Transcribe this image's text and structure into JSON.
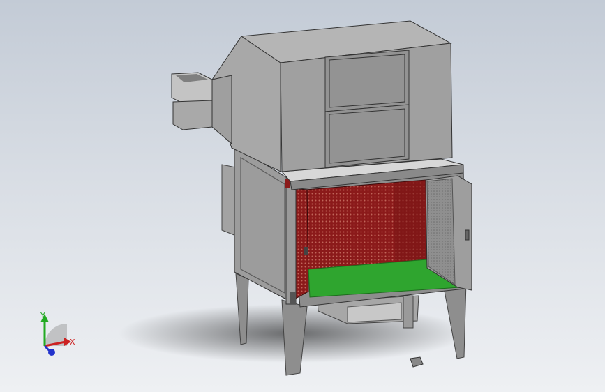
{
  "viewport": {
    "background_top": "#c3cbd6",
    "background_bottom": "#eef0f3"
  },
  "model": {
    "body_color": "#9a9a9a",
    "body_dark": "#7c7c7c",
    "body_light": "#b4b4b4",
    "filter_color": "#8b1a1a",
    "floor_color": "#2fa52f",
    "door_mesh_color": "#8a8a8a"
  },
  "triad": {
    "x_label": "X",
    "y_label": "Y",
    "x_color": "#cc2222",
    "y_color": "#22aa22",
    "z_color": "#2233cc"
  }
}
